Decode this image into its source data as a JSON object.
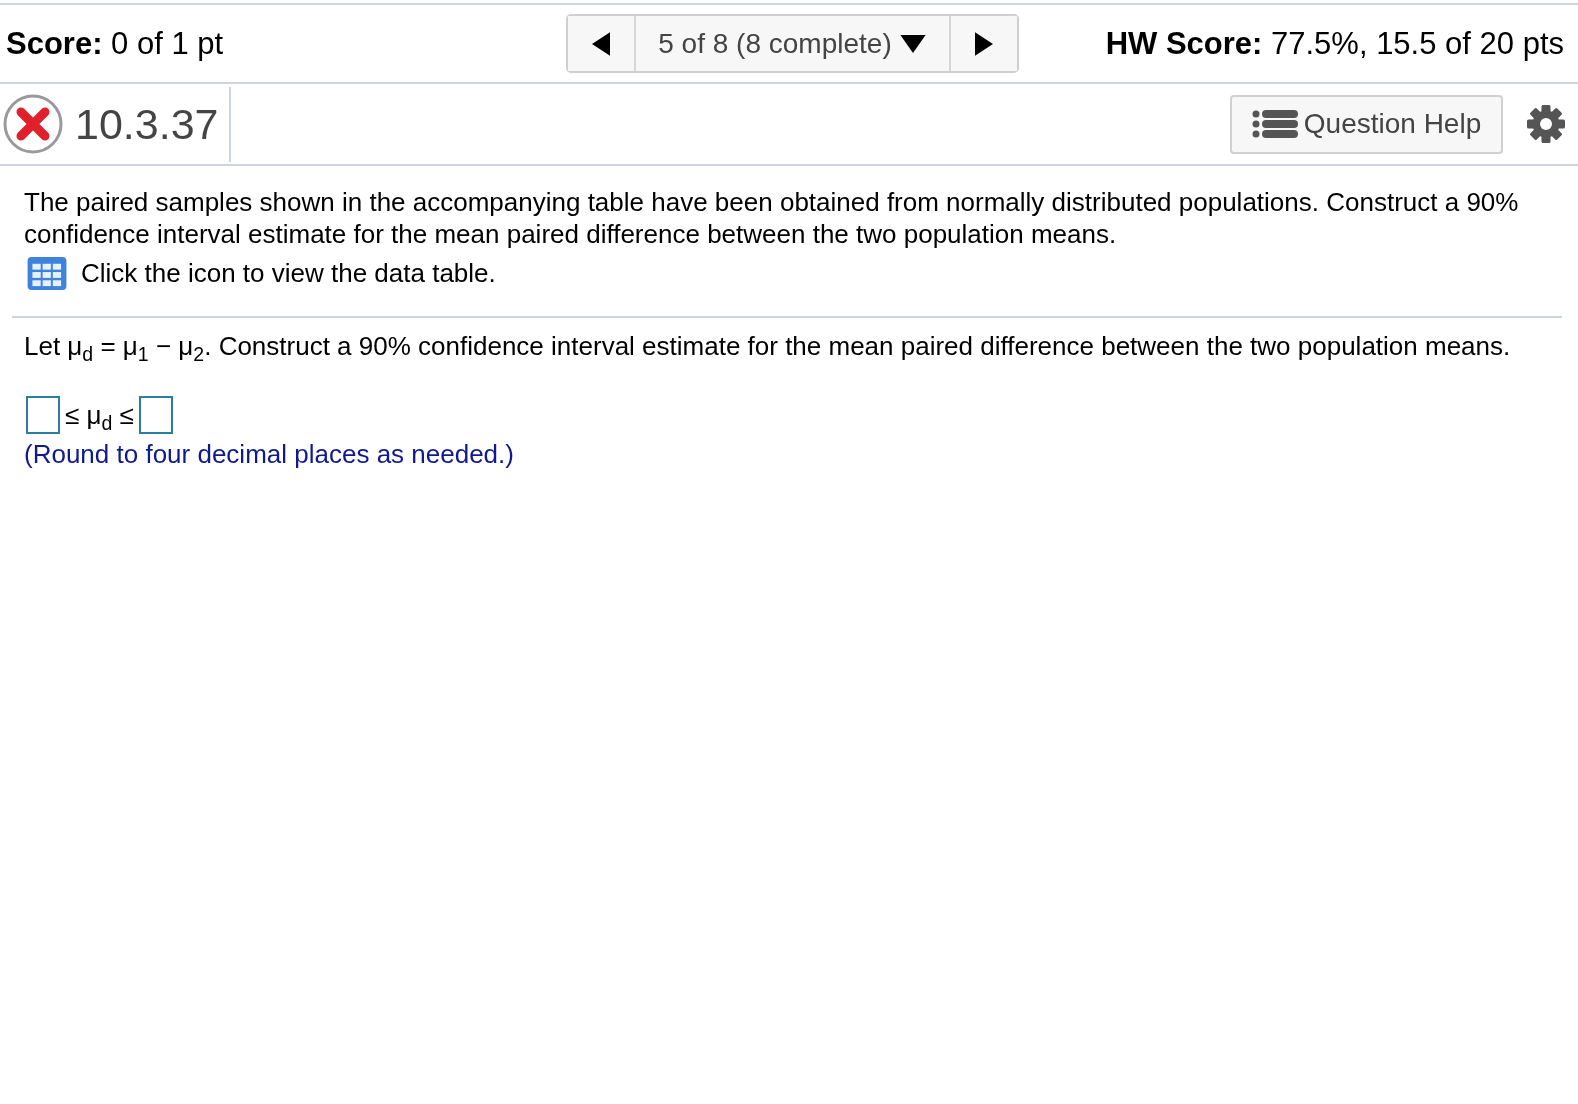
{
  "score_bar": {
    "score": "**Score:** 0 of 1 pt",
    "navigator": {
      "position": "5 of 8 (8 complete)"
    },
    "hw_score": "**HW Score:** 77.5%, 15.5 of 20 pts"
  },
  "question_header": {
    "correct": false,
    "number": "10.3.37",
    "help_button": "Question Help"
  },
  "intro": {
    "text": "The paired samples shown in the accompanying table have been obtained from normally distributed populations. Construct a 90% confidence interval estimate for the mean paired difference between the two population means.",
    "data_table_prompt": "Click the icon to view the data table."
  },
  "question": {
    "prompt": "Let μ$_{d}$ = μ$_{1}$ − μ$_{2}$. Construct a 90% confidence interval estimate for the mean paired difference between the two population means.",
    "answer": [
      {
        "kind": "input"
      },
      {
        "kind": "text",
        "text": "≤ μ$_{d}$ ≤"
      },
      {
        "kind": "input"
      }
    ],
    "hint": "(Round to four decimal places as needed.)"
  }
}
